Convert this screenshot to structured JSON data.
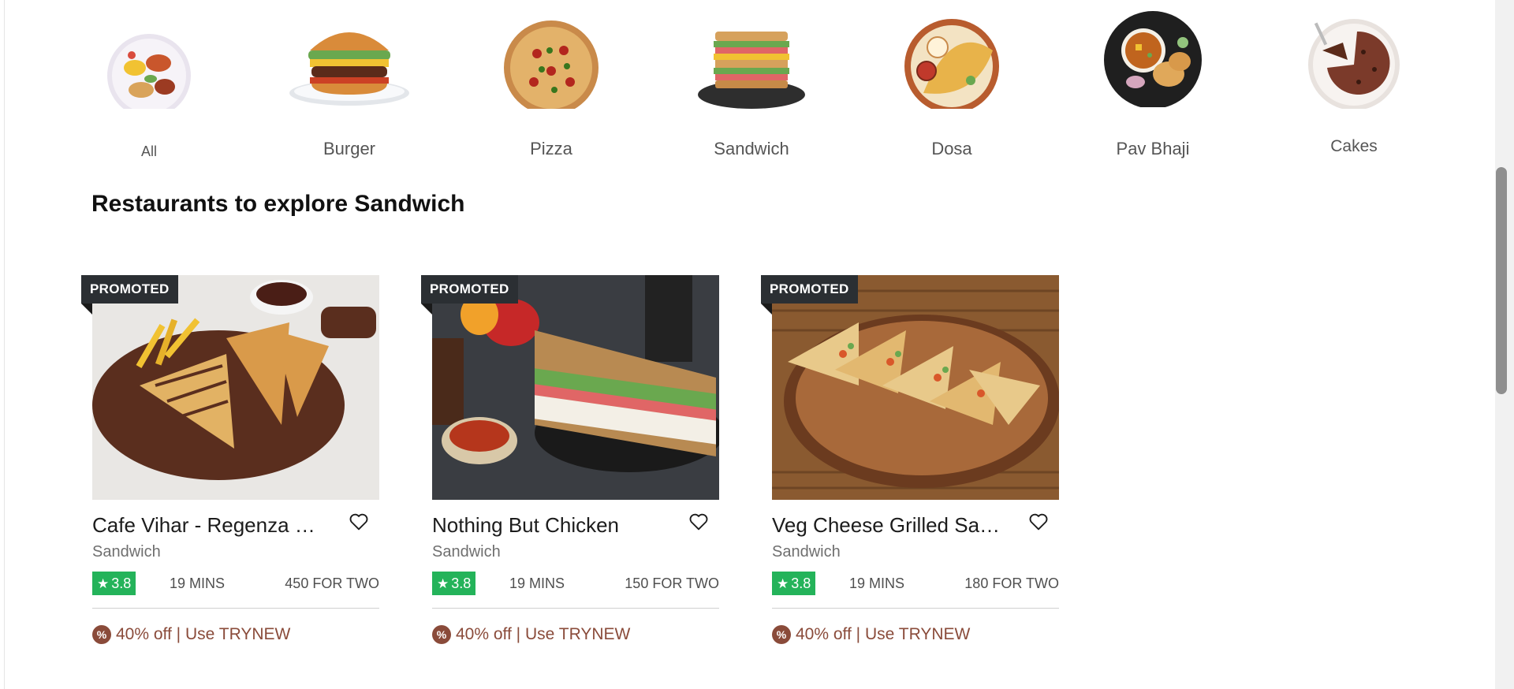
{
  "categories": [
    {
      "label": "All",
      "icon": "mixed-platter-icon"
    },
    {
      "label": "Burger",
      "icon": "burger-icon"
    },
    {
      "label": "Pizza",
      "icon": "pizza-icon"
    },
    {
      "label": "Sandwich",
      "icon": "sandwich-icon"
    },
    {
      "label": "Dosa",
      "icon": "dosa-icon"
    },
    {
      "label": "Pav Bhaji",
      "icon": "pav-bhaji-icon"
    },
    {
      "label": "Cakes",
      "icon": "cake-icon"
    }
  ],
  "section": {
    "title": "Restaurants to explore Sandwich"
  },
  "restaurants": [
    {
      "badge": "PROMOTED",
      "name": "Cafe Vihar - Regenza …",
      "cuisine": "Sandwich",
      "rating": "3.8",
      "time": "19 MINS",
      "cost": "450 FOR TWO",
      "offer": "40% off | Use TRYNEW"
    },
    {
      "badge": "PROMOTED",
      "name": "Nothing But Chicken",
      "cuisine": "Sandwich",
      "rating": "3.8",
      "time": "19 MINS",
      "cost": "150 FOR TWO",
      "offer": "40% off | Use TRYNEW"
    },
    {
      "badge": "PROMOTED",
      "name": "Veg Cheese Grilled Sa…",
      "cuisine": "Sandwich",
      "rating": "3.8",
      "time": "19 MINS",
      "cost": "180 FOR TWO",
      "offer": "40% off | Use TRYNEW"
    }
  ],
  "colors": {
    "rating_green": "#24b35a",
    "offer_brown": "#8a4b3a",
    "badge_dark": "#2b2f33"
  }
}
